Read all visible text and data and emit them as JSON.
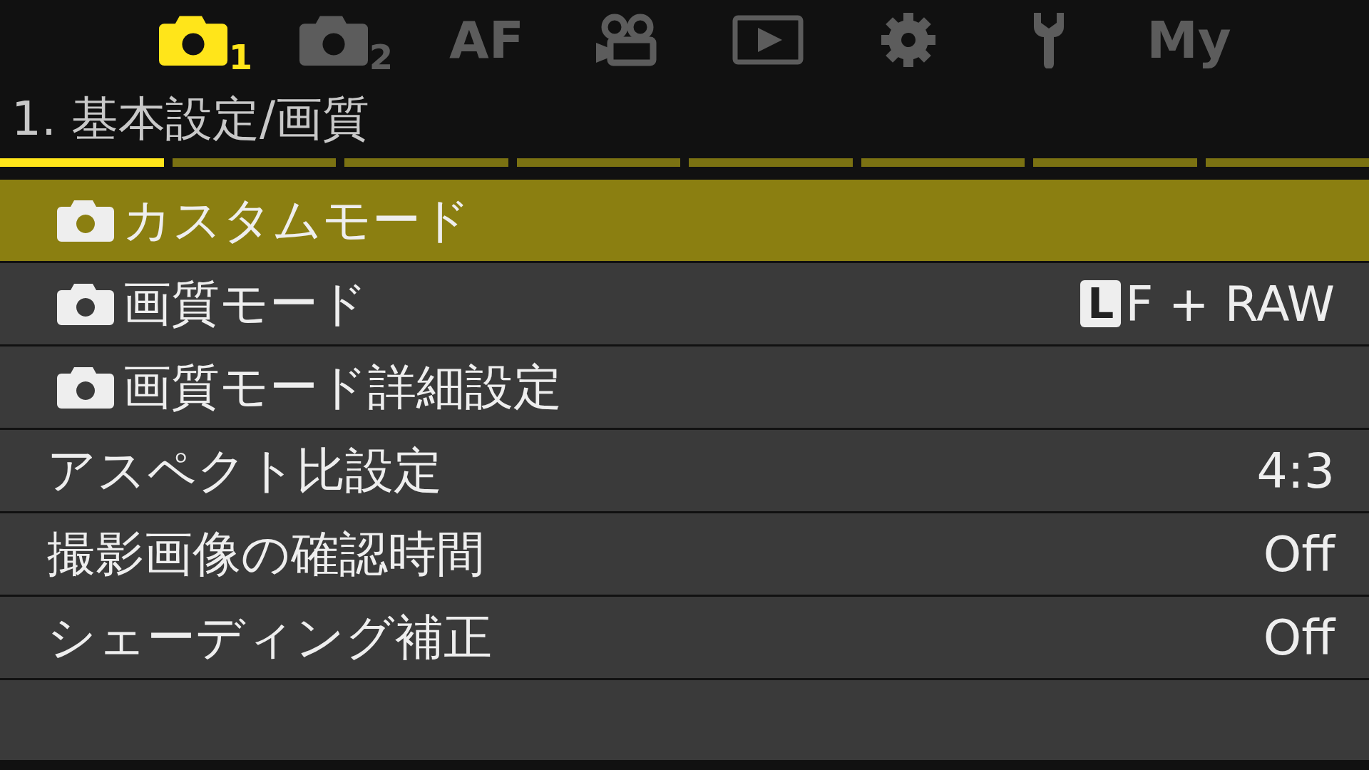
{
  "tabs": [
    {
      "kind": "camera",
      "label": "1",
      "selected": true
    },
    {
      "kind": "camera",
      "label": "2",
      "selected": false
    },
    {
      "kind": "text",
      "label": "AF",
      "selected": false
    },
    {
      "kind": "movie",
      "selected": false
    },
    {
      "kind": "playback",
      "selected": false
    },
    {
      "kind": "gear",
      "selected": false
    },
    {
      "kind": "wrench",
      "selected": false
    },
    {
      "kind": "text",
      "label": "My",
      "selected": false
    }
  ],
  "page_title": "1. 基本設定/画質",
  "pages": [
    {
      "selected": true
    },
    {
      "selected": false
    },
    {
      "selected": false
    },
    {
      "selected": false
    },
    {
      "selected": false
    },
    {
      "selected": false
    },
    {
      "selected": false
    },
    {
      "selected": false
    }
  ],
  "rows": [
    {
      "label": "カスタムモード",
      "camera_icon": true,
      "selected": true
    },
    {
      "label": "画質モード",
      "camera_icon": true,
      "selected": false,
      "value_badge": "L",
      "value": "F + RAW"
    },
    {
      "label": "画質モード詳細設定",
      "camera_icon": true,
      "selected": false
    },
    {
      "label": "アスペクト比設定",
      "camera_icon": false,
      "selected": false,
      "value": "4:3"
    },
    {
      "label": "撮影画像の確認時間",
      "camera_icon": false,
      "selected": false,
      "value": "Off"
    },
    {
      "label": "シェーディング補正",
      "camera_icon": false,
      "selected": false,
      "value": "Off"
    }
  ]
}
